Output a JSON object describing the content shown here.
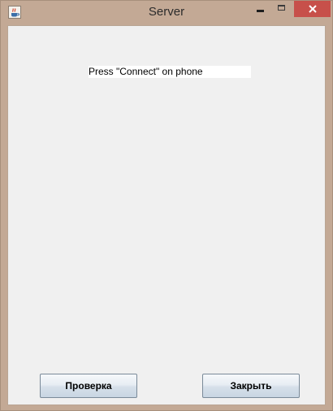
{
  "window": {
    "title": "Server",
    "app_icon": "java-cup-icon",
    "controls": {
      "minimize_icon": "minimize-icon",
      "maximize_icon": "maximize-icon",
      "close_icon": "close-icon",
      "close_color": "#c7504a"
    }
  },
  "main": {
    "status_text": "Press \"Connect\" on phone"
  },
  "buttons": {
    "check_label": "Проверка",
    "close_label": "Закрыть"
  }
}
